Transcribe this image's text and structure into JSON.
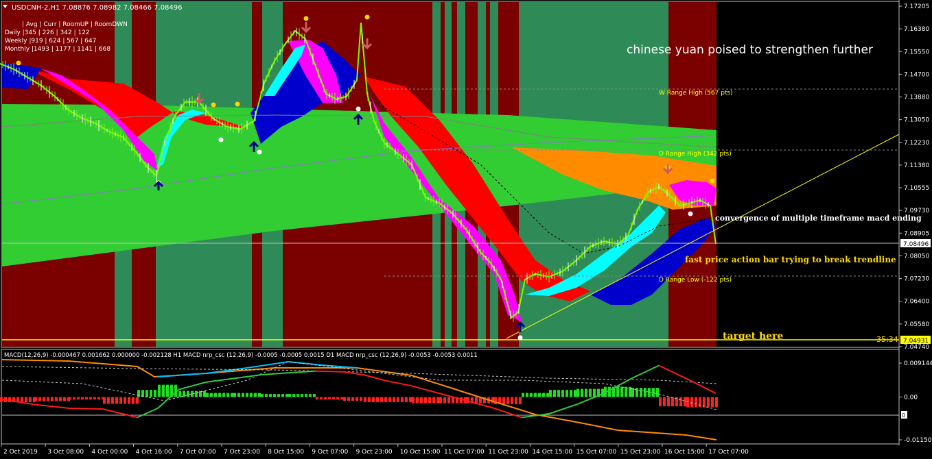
{
  "header": {
    "symbol_line": "USDCNH-2,H1  7.08876 7.08982 7.08466 7.08496",
    "rooms": "| Avg | Curr | RoomUP | RoomDWN",
    "rows": [
      "Daily   |345 | 226 | 342 | 122",
      "Weekly  |919 | 624 | 567 | 647",
      "Monthly |1493 | 1177 | 1141 | 668"
    ]
  },
  "annotations": {
    "title": "chinese yuan poised to strengthen further",
    "convergence": "convergence of multiple timeframe macd ending",
    "fast_price": "fast price action bar trying to break trendline",
    "target": "target here",
    "countdown": "35:34"
  },
  "levels": {
    "w_range_high": "W Range High (567 pts)",
    "d_range_high": "D Range High (342 pts)",
    "d_range_low": "D Range Low (-122 pts)"
  },
  "price_axis": {
    "ticks": [
      "7.17205",
      "7.16380",
      "7.15550",
      "7.14700",
      "7.13880",
      "7.13050",
      "7.12230",
      "7.11380",
      "7.10555",
      "7.09730",
      "7.08905",
      "7.08050",
      "7.07230",
      "7.06400",
      "7.05580",
      "7.04740"
    ],
    "current_price": "7.08496",
    "target_price": "7.04931"
  },
  "macd": {
    "label": "MACD(12,26,9) -0.000467 0.001662 0.000000 -0.002128  H1 MACD nrp_csc (12,26,9) -0.0005 -0.0005 0.0015  D1 MACD nrp_csc (12,26,9) -0.0053 -0.0053 0.0011",
    "ticks": [
      "0.009144",
      "0.00",
      "-0.011506"
    ],
    "zero_marker": "0"
  },
  "time_axis": {
    "labels": [
      "2 Oct 2019",
      "3 Oct 08:00",
      "4 Oct 00:00",
      "4 Oct 16:00",
      "7 Oct 07:00",
      "7 Oct 23:00",
      "8 Oct 15:00",
      "9 Oct 07:00",
      "9 Oct 23:00",
      "10 Oct 15:00",
      "11 Oct 07:00",
      "11 Oct 23:00",
      "14 Oct 15:00",
      "15 Oct 07:00",
      "15 Oct 23:00",
      "16 Oct 15:00",
      "17 Oct 07:00"
    ]
  },
  "colors": {
    "zone_red": "#7b0000",
    "zone_green": "#2e8b57",
    "lime": "#32cd32",
    "red": "#ff0000",
    "blue": "#0000cd",
    "magenta": "#ff00ff",
    "cyan": "#00ffff",
    "orange": "#ff8c00",
    "yellow": "#ffff00"
  },
  "chart_data": {
    "type": "line",
    "ylim": [
      7.0474,
      7.17205
    ],
    "close_path": [
      [
        0,
        7.151
      ],
      [
        20,
        7.149
      ],
      [
        40,
        7.146
      ],
      [
        60,
        7.143
      ],
      [
        80,
        7.139
      ],
      [
        100,
        7.134
      ],
      [
        120,
        7.131
      ],
      [
        140,
        7.129
      ],
      [
        160,
        7.126
      ],
      [
        180,
        7.124
      ],
      [
        200,
        7.118
      ],
      [
        215,
        7.113
      ],
      [
        228,
        7.11
      ],
      [
        240,
        7.122
      ],
      [
        255,
        7.132
      ],
      [
        270,
        7.137
      ],
      [
        290,
        7.137
      ],
      [
        310,
        7.131
      ],
      [
        330,
        7.128
      ],
      [
        350,
        7.127
      ],
      [
        370,
        7.13
      ],
      [
        385,
        7.144
      ],
      [
        400,
        7.152
      ],
      [
        415,
        7.158
      ],
      [
        430,
        7.163
      ],
      [
        445,
        7.16
      ],
      [
        460,
        7.15
      ],
      [
        475,
        7.14
      ],
      [
        490,
        7.138
      ],
      [
        505,
        7.139
      ],
      [
        520,
        7.145
      ],
      [
        526,
        7.166
      ],
      [
        535,
        7.14
      ],
      [
        545,
        7.13
      ],
      [
        560,
        7.122
      ],
      [
        580,
        7.118
      ],
      [
        600,
        7.114
      ],
      [
        620,
        7.102
      ],
      [
        640,
        7.1
      ],
      [
        660,
        7.096
      ],
      [
        680,
        7.09
      ],
      [
        700,
        7.082
      ],
      [
        715,
        7.078
      ],
      [
        730,
        7.072
      ],
      [
        745,
        7.058
      ],
      [
        755,
        7.06
      ],
      [
        765,
        7.072
      ],
      [
        780,
        7.074
      ],
      [
        800,
        7.073
      ],
      [
        820,
        7.075
      ],
      [
        840,
        7.079
      ],
      [
        860,
        7.084
      ],
      [
        880,
        7.086
      ],
      [
        900,
        7.085
      ],
      [
        915,
        7.088
      ],
      [
        930,
        7.098
      ],
      [
        945,
        7.104
      ],
      [
        960,
        7.106
      ],
      [
        975,
        7.103
      ],
      [
        990,
        7.099
      ],
      [
        1005,
        7.1
      ],
      [
        1020,
        7.101
      ],
      [
        1035,
        7.099
      ],
      [
        1043,
        7.085
      ]
    ],
    "macd_series": [
      {
        "values": [
          [
            0,
            -0.0005
          ],
          [
            50,
            -0.002
          ],
          [
            100,
            -0.003
          ],
          [
            150,
            -0.0032
          ],
          [
            200,
            -0.0055
          ],
          [
            230,
            -0.003
          ],
          [
            260,
            0.002
          ],
          [
            300,
            0.004
          ],
          [
            340,
            0.005
          ],
          [
            380,
            0.006
          ],
          [
            420,
            0.0065
          ],
          [
            460,
            0.007
          ],
          [
            500,
            0.0068
          ],
          [
            530,
            0.006
          ],
          [
            560,
            0.0045
          ],
          [
            600,
            0.003
          ],
          [
            640,
            0.001
          ],
          [
            680,
            -0.001
          ],
          [
            720,
            -0.003
          ],
          [
            760,
            -0.0055
          ],
          [
            800,
            -0.0045
          ],
          [
            840,
            -0.002
          ],
          [
            880,
            0.001
          ],
          [
            920,
            0.005
          ],
          [
            960,
            0.0085
          ],
          [
            1000,
            0.005
          ],
          [
            1043,
            0.001
          ]
        ]
      }
    ]
  }
}
